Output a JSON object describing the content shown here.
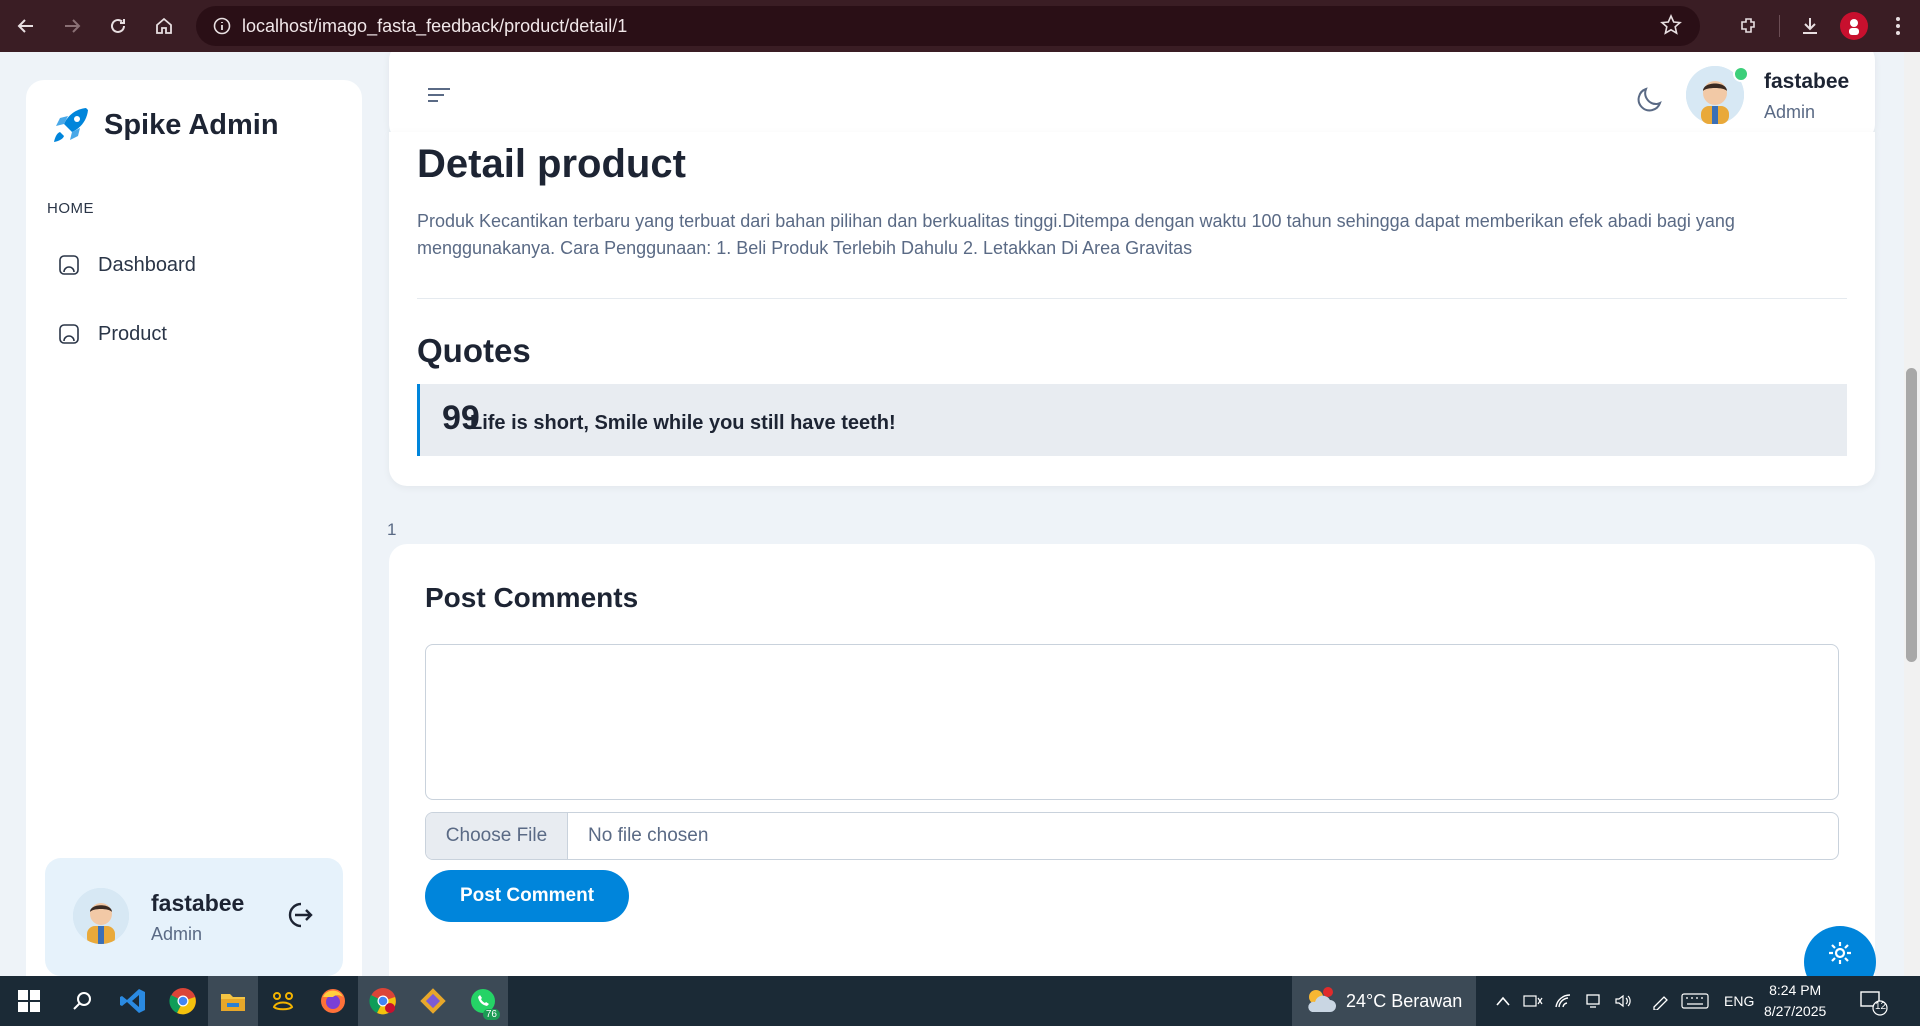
{
  "browser": {
    "url": "localhost/imago_fasta_feedback/product/detail/1"
  },
  "sidebar": {
    "brand": "Spike Admin",
    "section": "HOME",
    "items": [
      {
        "label": "Dashboard"
      },
      {
        "label": "Product"
      }
    ],
    "user": {
      "name": "fastabee",
      "role": "Admin"
    }
  },
  "header": {
    "user_name": "fastabee",
    "user_role": "Admin"
  },
  "detail": {
    "title": "Detail product",
    "description": "Produk Kecantikan terbaru yang terbuat dari bahan pilihan dan berkualitas tinggi.Ditempa dengan waktu 100 tahun sehingga dapat memberikan efek abadi bagi yang menggunakanya. Cara Penggunaan: 1. Beli Produk Terlebih Dahulu 2. Letakkan Di Area Gravitas",
    "quotes_title": "Quotes",
    "quote_mark": "99",
    "quote": "Life is short, Smile while you still have teeth!"
  },
  "count_label": "1",
  "comments": {
    "title": "Post Comments",
    "comment_value": "",
    "choose_file_label": "Choose File",
    "no_file_label": "No file chosen",
    "post_button": "Post Comment"
  },
  "taskbar": {
    "weather": "24°C  Berawan",
    "weather_badge": "1",
    "whatsapp_badge": "76",
    "language": "ENG",
    "time": "8:24 PM",
    "date": "8/27/2025",
    "notifications": "12"
  },
  "colors": {
    "accent": "#0085db",
    "browser_bar": "#3a1d24",
    "online": "#3ccf7a"
  }
}
